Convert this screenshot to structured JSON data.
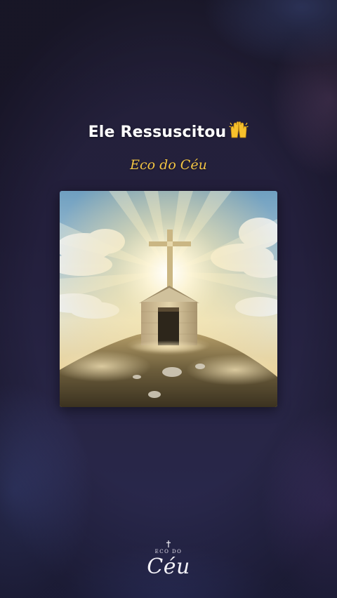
{
  "post": {
    "title": "Ele Ressuscitou",
    "title_emoji": "🙌",
    "subtitle": "Eco do Céu"
  },
  "cover_image": {
    "icon": "cross-chapel-image"
  },
  "watermark": {
    "small_text": "ECO DO",
    "main_text": "Céu"
  },
  "colors": {
    "title": "#ffffff",
    "subtitle": "#f3c545",
    "background": "#231f3c"
  }
}
